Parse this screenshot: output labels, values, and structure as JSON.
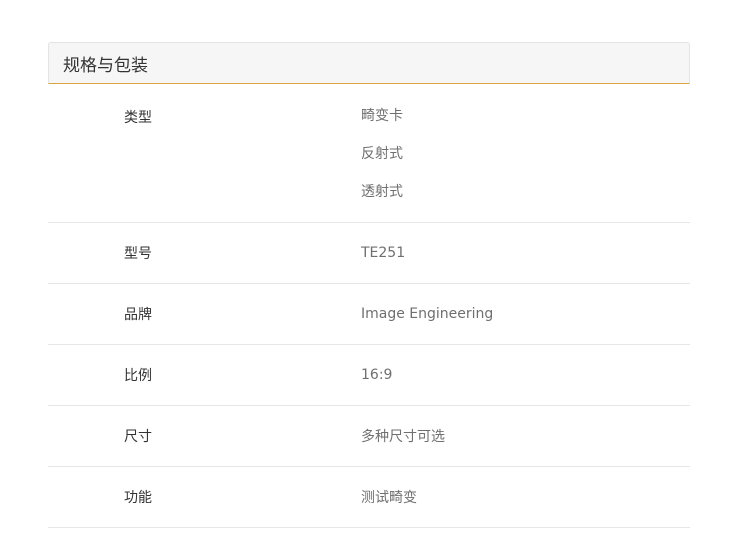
{
  "section": {
    "title": "规格与包装"
  },
  "specs": [
    {
      "label": "类型",
      "values": [
        "畸变卡",
        "反射式",
        "透射式"
      ]
    },
    {
      "label": "型号",
      "values": [
        "TE251"
      ]
    },
    {
      "label": "品牌",
      "values": [
        "Image Engineering"
      ]
    },
    {
      "label": "比例",
      "values": [
        "16:9"
      ]
    },
    {
      "label": "尺寸",
      "values": [
        "多种尺寸可选"
      ]
    },
    {
      "label": "功能",
      "values": [
        "测试畸变"
      ]
    }
  ]
}
